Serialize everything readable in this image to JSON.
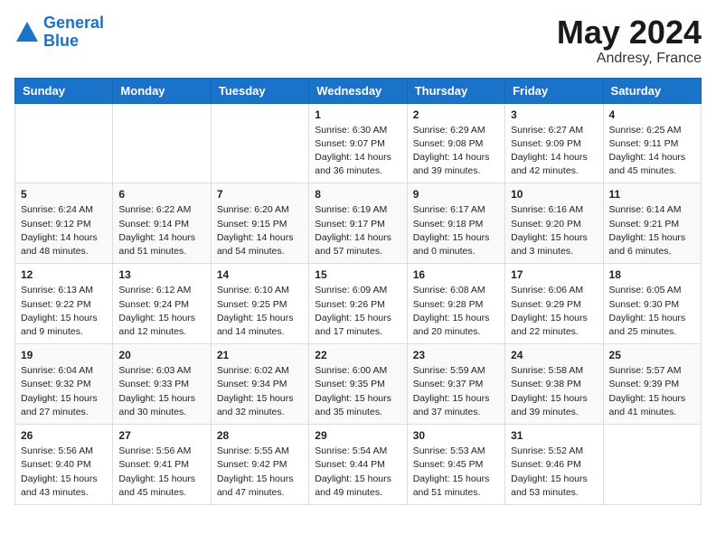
{
  "logo": {
    "line1": "General",
    "line2": "Blue"
  },
  "title": "May 2024",
  "location": "Andresy, France",
  "days_of_week": [
    "Sunday",
    "Monday",
    "Tuesday",
    "Wednesday",
    "Thursday",
    "Friday",
    "Saturday"
  ],
  "weeks": [
    [
      {
        "day": "",
        "info": ""
      },
      {
        "day": "",
        "info": ""
      },
      {
        "day": "",
        "info": ""
      },
      {
        "day": "1",
        "info": "Sunrise: 6:30 AM\nSunset: 9:07 PM\nDaylight: 14 hours\nand 36 minutes."
      },
      {
        "day": "2",
        "info": "Sunrise: 6:29 AM\nSunset: 9:08 PM\nDaylight: 14 hours\nand 39 minutes."
      },
      {
        "day": "3",
        "info": "Sunrise: 6:27 AM\nSunset: 9:09 PM\nDaylight: 14 hours\nand 42 minutes."
      },
      {
        "day": "4",
        "info": "Sunrise: 6:25 AM\nSunset: 9:11 PM\nDaylight: 14 hours\nand 45 minutes."
      }
    ],
    [
      {
        "day": "5",
        "info": "Sunrise: 6:24 AM\nSunset: 9:12 PM\nDaylight: 14 hours\nand 48 minutes."
      },
      {
        "day": "6",
        "info": "Sunrise: 6:22 AM\nSunset: 9:14 PM\nDaylight: 14 hours\nand 51 minutes."
      },
      {
        "day": "7",
        "info": "Sunrise: 6:20 AM\nSunset: 9:15 PM\nDaylight: 14 hours\nand 54 minutes."
      },
      {
        "day": "8",
        "info": "Sunrise: 6:19 AM\nSunset: 9:17 PM\nDaylight: 14 hours\nand 57 minutes."
      },
      {
        "day": "9",
        "info": "Sunrise: 6:17 AM\nSunset: 9:18 PM\nDaylight: 15 hours\nand 0 minutes."
      },
      {
        "day": "10",
        "info": "Sunrise: 6:16 AM\nSunset: 9:20 PM\nDaylight: 15 hours\nand 3 minutes."
      },
      {
        "day": "11",
        "info": "Sunrise: 6:14 AM\nSunset: 9:21 PM\nDaylight: 15 hours\nand 6 minutes."
      }
    ],
    [
      {
        "day": "12",
        "info": "Sunrise: 6:13 AM\nSunset: 9:22 PM\nDaylight: 15 hours\nand 9 minutes."
      },
      {
        "day": "13",
        "info": "Sunrise: 6:12 AM\nSunset: 9:24 PM\nDaylight: 15 hours\nand 12 minutes."
      },
      {
        "day": "14",
        "info": "Sunrise: 6:10 AM\nSunset: 9:25 PM\nDaylight: 15 hours\nand 14 minutes."
      },
      {
        "day": "15",
        "info": "Sunrise: 6:09 AM\nSunset: 9:26 PM\nDaylight: 15 hours\nand 17 minutes."
      },
      {
        "day": "16",
        "info": "Sunrise: 6:08 AM\nSunset: 9:28 PM\nDaylight: 15 hours\nand 20 minutes."
      },
      {
        "day": "17",
        "info": "Sunrise: 6:06 AM\nSunset: 9:29 PM\nDaylight: 15 hours\nand 22 minutes."
      },
      {
        "day": "18",
        "info": "Sunrise: 6:05 AM\nSunset: 9:30 PM\nDaylight: 15 hours\nand 25 minutes."
      }
    ],
    [
      {
        "day": "19",
        "info": "Sunrise: 6:04 AM\nSunset: 9:32 PM\nDaylight: 15 hours\nand 27 minutes."
      },
      {
        "day": "20",
        "info": "Sunrise: 6:03 AM\nSunset: 9:33 PM\nDaylight: 15 hours\nand 30 minutes."
      },
      {
        "day": "21",
        "info": "Sunrise: 6:02 AM\nSunset: 9:34 PM\nDaylight: 15 hours\nand 32 minutes."
      },
      {
        "day": "22",
        "info": "Sunrise: 6:00 AM\nSunset: 9:35 PM\nDaylight: 15 hours\nand 35 minutes."
      },
      {
        "day": "23",
        "info": "Sunrise: 5:59 AM\nSunset: 9:37 PM\nDaylight: 15 hours\nand 37 minutes."
      },
      {
        "day": "24",
        "info": "Sunrise: 5:58 AM\nSunset: 9:38 PM\nDaylight: 15 hours\nand 39 minutes."
      },
      {
        "day": "25",
        "info": "Sunrise: 5:57 AM\nSunset: 9:39 PM\nDaylight: 15 hours\nand 41 minutes."
      }
    ],
    [
      {
        "day": "26",
        "info": "Sunrise: 5:56 AM\nSunset: 9:40 PM\nDaylight: 15 hours\nand 43 minutes."
      },
      {
        "day": "27",
        "info": "Sunrise: 5:56 AM\nSunset: 9:41 PM\nDaylight: 15 hours\nand 45 minutes."
      },
      {
        "day": "28",
        "info": "Sunrise: 5:55 AM\nSunset: 9:42 PM\nDaylight: 15 hours\nand 47 minutes."
      },
      {
        "day": "29",
        "info": "Sunrise: 5:54 AM\nSunset: 9:44 PM\nDaylight: 15 hours\nand 49 minutes."
      },
      {
        "day": "30",
        "info": "Sunrise: 5:53 AM\nSunset: 9:45 PM\nDaylight: 15 hours\nand 51 minutes."
      },
      {
        "day": "31",
        "info": "Sunrise: 5:52 AM\nSunset: 9:46 PM\nDaylight: 15 hours\nand 53 minutes."
      },
      {
        "day": "",
        "info": ""
      }
    ]
  ]
}
